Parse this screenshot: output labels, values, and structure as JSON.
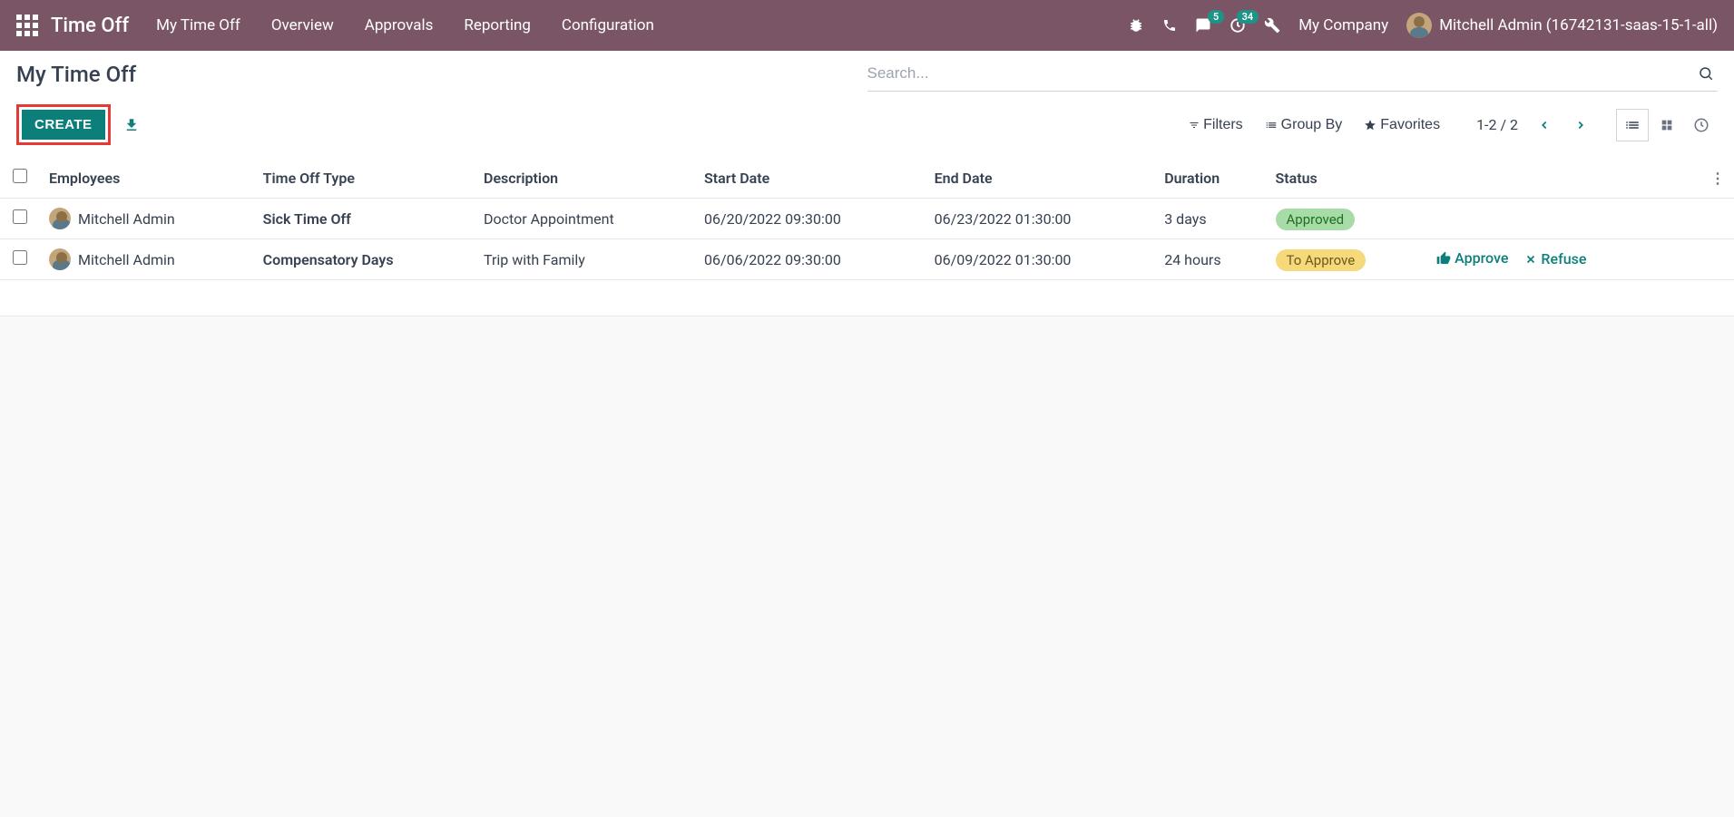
{
  "nav": {
    "brand": "Time Off",
    "menu": [
      "My Time Off",
      "Overview",
      "Approvals",
      "Reporting",
      "Configuration"
    ],
    "chat_badge": "5",
    "activity_badge": "34",
    "company": "My Company",
    "user": "Mitchell Admin (16742131-saas-15-1-all)"
  },
  "cp": {
    "title": "My Time Off",
    "create": "CREATE",
    "search_placeholder": "Search...",
    "filters": "Filters",
    "groupby": "Group By",
    "favorites": "Favorites",
    "pager": "1-2 / 2"
  },
  "table": {
    "headers": {
      "employees": "Employees",
      "type": "Time Off Type",
      "description": "Description",
      "start": "Start Date",
      "end": "End Date",
      "duration": "Duration",
      "status": "Status"
    },
    "rows": [
      {
        "employee": "Mitchell Admin",
        "type": "Sick Time Off",
        "description": "Doctor Appointment",
        "start": "06/20/2022 09:30:00",
        "end": "06/23/2022 01:30:00",
        "duration": "3 days",
        "status": "Approved",
        "status_class": "status-approved",
        "actions": false
      },
      {
        "employee": "Mitchell Admin",
        "type": "Compensatory Days",
        "description": "Trip with Family",
        "start": "06/06/2022 09:30:00",
        "end": "06/09/2022 01:30:00",
        "duration": "24 hours",
        "status": "To Approve",
        "status_class": "status-toapprove",
        "actions": true
      }
    ],
    "approve": "Approve",
    "refuse": "Refuse"
  }
}
